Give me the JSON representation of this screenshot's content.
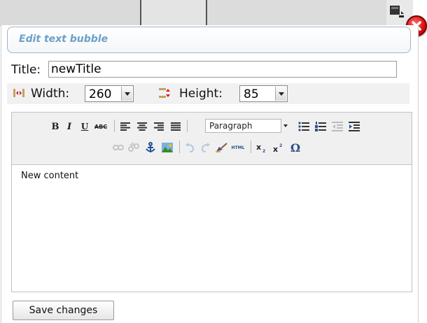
{
  "dialog": {
    "header_title": "Edit text bubble",
    "title_label": "Title:",
    "title_value": "newTitle",
    "width_label": "Width:",
    "width_value": "260",
    "height_label": "Height:",
    "height_value": "85",
    "save_label": "Save changes"
  },
  "editor": {
    "format_value": "Paragraph",
    "html_label": "HTML",
    "content": "New content",
    "toolbar_row1": [
      "bold-icon",
      "italic-icon",
      "underline-icon",
      "strikethrough-icon",
      "align-left-icon",
      "align-center-icon",
      "align-right-icon",
      "align-justify-icon",
      "format-select",
      "bullet-list-icon",
      "numbered-list-icon",
      "outdent-icon",
      "indent-icon"
    ],
    "toolbar_row2": [
      "link-icon",
      "unlink-icon",
      "anchor-icon",
      "image-icon",
      "undo-icon",
      "redo-icon",
      "cleanup-icon",
      "html-icon",
      "subscript-icon",
      "superscript-icon",
      "omega-icon"
    ]
  },
  "colors": {
    "header_title": "#6ba0c8",
    "close_button": "#d81010",
    "anchor_icon": "#1c4f9c"
  }
}
